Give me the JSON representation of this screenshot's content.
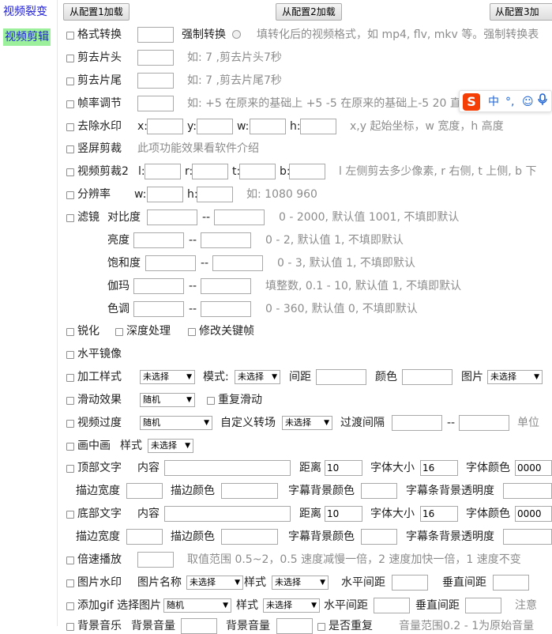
{
  "sidebar": {
    "items": [
      {
        "label": "视频裂变"
      },
      {
        "label": "视频剪辑"
      }
    ]
  },
  "toolbar": {
    "load1": "从配置1加载",
    "load2": "从配置2加载",
    "load3": "从配置3加"
  },
  "ime": {
    "logo": "S",
    "lang": "中",
    "punct": "°,",
    "emoji": "☺",
    "mic": "🎤"
  },
  "format": {
    "label": "格式转换",
    "force_label": "强制转换",
    "hint": "填转化后的视频格式，如 mp4, flv, mkv 等。强制转换表"
  },
  "cut_head": {
    "label": "剪去片头",
    "hint": "如: 7 ,剪去片头7秒"
  },
  "cut_tail": {
    "label": "剪去片尾",
    "hint": "如: 7 ,剪去片尾7秒"
  },
  "framerate": {
    "label": "帧率调节",
    "hint": "如: +5 在原来的基础上 +5 -5 在原来的基础上-5 20 直"
  },
  "watermark": {
    "label": "去除水印",
    "x": "x:",
    "y": "y:",
    "w": "w:",
    "h": "h:",
    "hint": "x,y 起始坐标，w 宽度，h 高度"
  },
  "vertical": {
    "label": "竖屏剪裁",
    "hint": "此项功能效果看软件介绍"
  },
  "crop2": {
    "label": "视频剪裁2",
    "l": "l:",
    "r": "r:",
    "t": "t:",
    "b": "b:",
    "hint": "l 左侧剪去多少像素, r 右侧, t 上侧, b 下"
  },
  "resolution": {
    "label": "分辨率",
    "w": "w:",
    "h": "h:",
    "hint": "如: 1080 960"
  },
  "filter": {
    "label": "滤镜",
    "rows": [
      {
        "name": "对比度",
        "sep": "--",
        "hint": "0 - 2000, 默认值 1001, 不填即默认"
      },
      {
        "name": "亮度",
        "sep": "--",
        "hint": "0 - 2, 默认值 1, 不填即默认"
      },
      {
        "name": "饱和度",
        "sep": "--",
        "hint": "0 - 3, 默认值 1, 不填即默认"
      },
      {
        "name": "伽玛",
        "sep": "--",
        "hint": "填整数, 0.1 - 10, 默认值 1, 不填即默认"
      },
      {
        "name": "色调",
        "sep": "--",
        "hint": "0 - 360, 默认值 0, 不填即默认"
      }
    ]
  },
  "sharpen": {
    "label": "锐化",
    "deep": "深度处理",
    "keyframe": "修改关键帧"
  },
  "mirror": {
    "label": "水平镜像"
  },
  "style": {
    "label": "加工样式",
    "select": "未选择",
    "mode_label": "模式:",
    "mode_select": "未选择",
    "gap_label": "间距",
    "color_label": "颜色",
    "image_label": "图片",
    "image_select": "未选择"
  },
  "slide": {
    "label": "滑动效果",
    "select": "随机",
    "repeat": "重复滑动"
  },
  "transition": {
    "label": "视频过度",
    "select": "随机",
    "custom_label": "自定义转场",
    "custom_select": "未选择",
    "interval_label": "过渡间隔",
    "sep": "--",
    "unit": "单位"
  },
  "pip": {
    "label": "画中画",
    "style_label": "样式",
    "style_select": "未选择"
  },
  "top_text": {
    "label": "顶部文字",
    "content_label": "内容",
    "dist_label": "距离",
    "dist_value": "10",
    "size_label": "字体大小",
    "size_value": "16",
    "color_label": "字体颜色",
    "color_value": "0000"
  },
  "top_text2": {
    "stroke_width": "描边宽度",
    "stroke_color": "描边颜色",
    "bg_color": "字幕背景颜色",
    "bg_alpha": "字幕条背景透明度"
  },
  "bottom_text": {
    "label": "底部文字",
    "content_label": "内容",
    "dist_label": "距离",
    "dist_value": "10",
    "size_label": "字体大小",
    "size_value": "16",
    "color_label": "字体颜色",
    "color_value": "0000"
  },
  "bottom_text2": {
    "stroke_width": "描边宽度",
    "stroke_color": "描边颜色",
    "bg_color": "字幕背景颜色",
    "bg_alpha": "字幕条背景透明度"
  },
  "speed": {
    "label": "倍速播放",
    "hint": "取值范围 0.5~2，0.5 速度减慢一倍，2 速度加快一倍，1 速度不变"
  },
  "img_watermark": {
    "label": "图片水印",
    "name_label": "图片名称",
    "name_select": "未选择",
    "style_label": "样式",
    "style_select": "未选择",
    "hgap_label": "水平间距",
    "vgap_label": "垂直间距"
  },
  "gif": {
    "label": "添加gif 选择图片",
    "select": "随机",
    "style_label": "样式",
    "style_select": "未选择",
    "hgap_label": "水平间距",
    "vgap_label": "垂直间距",
    "note": "注意"
  },
  "bgm": {
    "label": "背景音乐",
    "bg_vol": "背景音量",
    "bg_vol2": "背景音量",
    "no_repeat": "是否重复",
    "hint": "音量范围0.2 - 1为原始音量"
  }
}
